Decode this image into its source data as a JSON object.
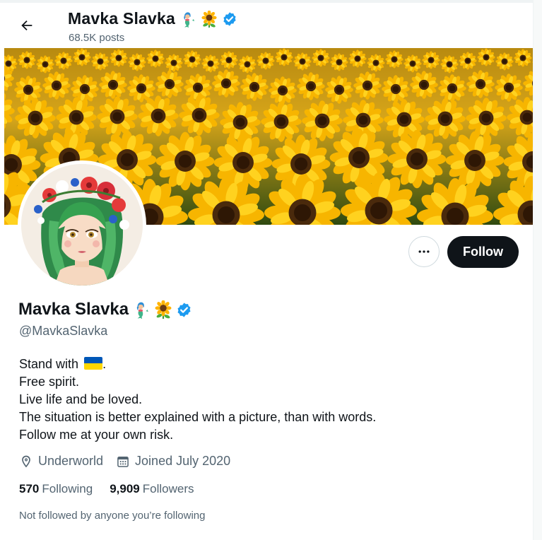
{
  "header": {
    "name": "Mavka Slavka",
    "posts_count": "68.5K posts"
  },
  "profile": {
    "display_name": "Mavka Slavka",
    "handle": "@MavkaSlavka",
    "verified": true,
    "name_emojis": [
      "mermaid-emoji",
      "sunflower-emoji"
    ]
  },
  "bio": {
    "line1_prefix": "Stand with",
    "line1_suffix": ".",
    "line2": "Free spirit.",
    "line3": "Live life and be loved.",
    "line4": "The situation is better explained with a picture, than with words.",
    "line5": "Follow me at your own risk."
  },
  "meta": {
    "location": "Underworld",
    "joined": "Joined July 2020"
  },
  "stats": {
    "following_count": "570",
    "following_label": "Following",
    "followers_count": "9,909",
    "followers_label": "Followers"
  },
  "social_context": "Not followed by anyone you’re following",
  "actions": {
    "follow_label": "Follow"
  },
  "icons": {
    "back": "arrow-left-icon",
    "more": "more-horizontal-icon",
    "verified": "verified-badge-icon",
    "location": "location-pin-icon",
    "calendar": "calendar-icon",
    "flag": "ukraine-flag-emoji"
  },
  "colors": {
    "verified_blue": "#1d9bf0",
    "follow_button_bg": "#0f1419",
    "secondary_text": "#536471",
    "flag_blue": "#0057b7",
    "flag_yellow": "#ffd700"
  }
}
